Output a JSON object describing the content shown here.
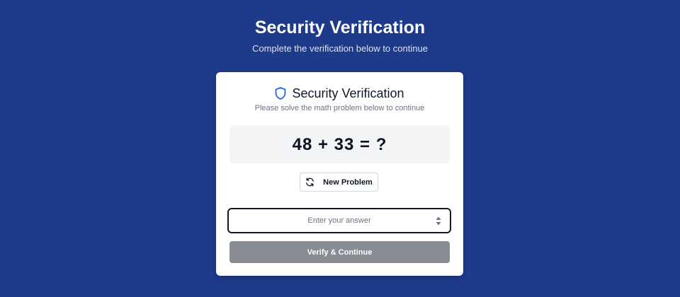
{
  "page": {
    "title": "Security Verification",
    "subtitle": "Complete the verification below to continue",
    "background_color": "#1e3a8a"
  },
  "card": {
    "icon": "shield-icon",
    "title": "Security Verification",
    "subtitle": "Please solve the math problem below to continue",
    "problem": "48 + 33 = ?",
    "new_problem_button": {
      "icon": "refresh-icon",
      "label": "New Problem"
    },
    "answer_input": {
      "value": "",
      "placeholder": "Enter your answer"
    },
    "verify_button": {
      "label": "Verify & Continue",
      "color": "#878b92"
    },
    "accent_color": "#2563eb"
  }
}
